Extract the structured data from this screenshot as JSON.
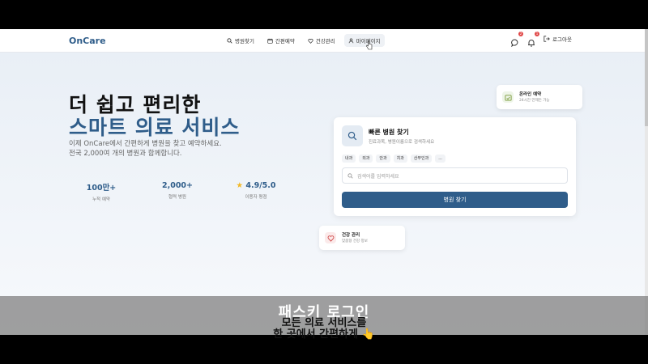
{
  "app": {
    "logo": "OnCare"
  },
  "nav": [
    {
      "label": "병원찾기",
      "icon": "search-icon"
    },
    {
      "label": "간편예약",
      "icon": "calendar-icon"
    },
    {
      "label": "건강관리",
      "icon": "health-icon"
    },
    {
      "label": "마이페이지",
      "icon": "user-icon",
      "active": true
    }
  ],
  "header": {
    "chat_badge": "2",
    "bell_badge": "1",
    "logout_label": "로그아웃"
  },
  "hero": {
    "title_line1": "더 쉽고 편리한",
    "title_line2": "스마트 의료 서비스",
    "desc_line1": "이제 OnCare에서 간편하게 병원을 찾고 예약하세요.",
    "desc_line2": "전국 2,000여 개의 병원과 함께합니다."
  },
  "stats": [
    {
      "value": "100만+",
      "label": "누적 예약"
    },
    {
      "value": "2,000+",
      "label": "협력 병원"
    },
    {
      "value": "4.9/5.0",
      "label": "이용자 평점",
      "icon": "star-icon"
    }
  ],
  "quick_search": {
    "title": "빠른 병원 찾기",
    "subtitle": "진료과목, 병원이름으로 검색하세요",
    "chips": [
      "내과",
      "외과",
      "안과",
      "치과",
      "산부인과",
      "..."
    ],
    "placeholder": "검색어를 입력하세요",
    "button": "병원 찾기"
  },
  "float_cards": {
    "online": {
      "title": "온라인 예약",
      "subtitle": "24시간 언제든 가능"
    },
    "health": {
      "title": "건강 관리",
      "subtitle": "맞춤형 건강 정보"
    }
  },
  "caption": {
    "line1": "패스키 로그인",
    "line2": "모든 의료 서비스를",
    "line3": "한 곳에서 간편하게 👆"
  },
  "colors": {
    "brand": "#2f5d8a",
    "badge": "#e04848"
  }
}
